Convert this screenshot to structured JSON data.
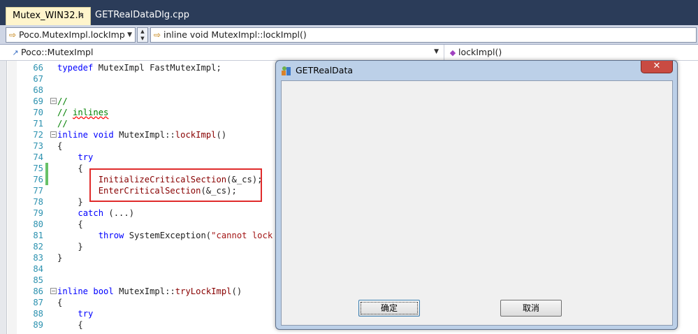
{
  "tabs": [
    {
      "label": "Mutex_WIN32.h",
      "active": true
    },
    {
      "label": "GETRealDataDlg.cpp",
      "active": false
    }
  ],
  "nav": {
    "scope_combo": "Poco.MutexImpl.lockImp",
    "function_combo": "inline void MutexImpl::lockImpl()",
    "class_combo": "Poco::MutexImpl",
    "member_combo": "lockImpl()"
  },
  "lines": [
    {
      "n": "66",
      "html": "<span class='kw'>typedef</span> MutexImpl FastMutexImpl;"
    },
    {
      "n": "67",
      "html": ""
    },
    {
      "n": "68",
      "html": ""
    },
    {
      "n": "69",
      "html": "<span class='cm'>//</span>"
    },
    {
      "n": "70",
      "html": "<span class='cm'>// <span class='squig'>inlines</span></span>"
    },
    {
      "n": "71",
      "html": "<span class='cm'>//</span>"
    },
    {
      "n": "72",
      "html": "<span class='kw'>inline</span> <span class='kw'>void</span> MutexImpl::<span class='fn'>lockImpl</span>()"
    },
    {
      "n": "73",
      "html": "{"
    },
    {
      "n": "74",
      "html": "    <span class='kw'>try</span>"
    },
    {
      "n": "75",
      "html": "    {"
    },
    {
      "n": "76",
      "html": "        <span class='fn'>InitializeCriticalSection</span>(&amp;_cs);"
    },
    {
      "n": "77",
      "html": "        <span class='fn'>EnterCriticalSection</span>(&amp;_cs);"
    },
    {
      "n": "78",
      "html": "    }"
    },
    {
      "n": "79",
      "html": "    <span class='kw'>catch</span> (...)"
    },
    {
      "n": "80",
      "html": "    {"
    },
    {
      "n": "81",
      "html": "        <span class='kw'>throw</span> SystemException(<span class='st'>\"cannot lock mu</span>"
    },
    {
      "n": "82",
      "html": "    }"
    },
    {
      "n": "83",
      "html": "}"
    },
    {
      "n": "84",
      "html": ""
    },
    {
      "n": "85",
      "html": ""
    },
    {
      "n": "86",
      "html": "<span class='kw'>inline</span> <span class='kw'>bool</span> MutexImpl::<span class='fn'>tryLockImpl</span>()"
    },
    {
      "n": "87",
      "html": "{"
    },
    {
      "n": "88",
      "html": "    <span class='kw'>try</span>"
    },
    {
      "n": "89",
      "html": "    {"
    }
  ],
  "dialog": {
    "title": "GETRealData",
    "ok_label": "确定",
    "cancel_label": "取消",
    "close_glyph": "✕"
  },
  "colors": {
    "accent_box": "#e02b2b",
    "tab_active": "#fff5cc",
    "line_number": "#2b91af",
    "keyword": "#0000ff"
  }
}
